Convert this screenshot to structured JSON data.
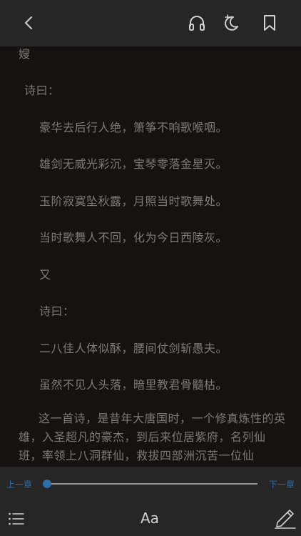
{
  "top_bar": {
    "icons": [
      "back-arrow-icon",
      "headphones-icon",
      "night-mode-icon",
      "bookmark-icon"
    ]
  },
  "content": {
    "lines": [
      "嫂",
      "诗曰：",
      "豪华去后行人绝，箫筝不响歌喉咽。",
      "雄剑无威光彩沉，宝琴零落金星灭。",
      "玉阶寂寞坠秋露，月照当时歌舞处。",
      "当时歌舞人不回，化为今日西陵灰。",
      "又",
      "诗曰：",
      "二八佳人体似酥，腰间仗剑斩愚夫。",
      "虽然不见人头落，暗里教君骨髓枯。"
    ],
    "paragraph": "这一首诗，是昔年大唐国时，一个修真炼性的英雄，入圣超凡的豪杰，到后来位居紫府，名列仙班，率领上八洞群仙，救拔四部洲沉苦一位仙"
  },
  "bottom_bar": {
    "prev_chapter": "上一章",
    "next_chapter": "下一章",
    "progress": 0,
    "font_button": "Aa",
    "icons": [
      "menu-list-icon",
      "font-size-icon",
      "pencil-note-icon"
    ]
  },
  "colors": {
    "bar_background": "#262626",
    "page_background": "#17120f",
    "text": "#7f7a75",
    "accent": "#2f6ea8",
    "icon": "#d0d0d0"
  }
}
